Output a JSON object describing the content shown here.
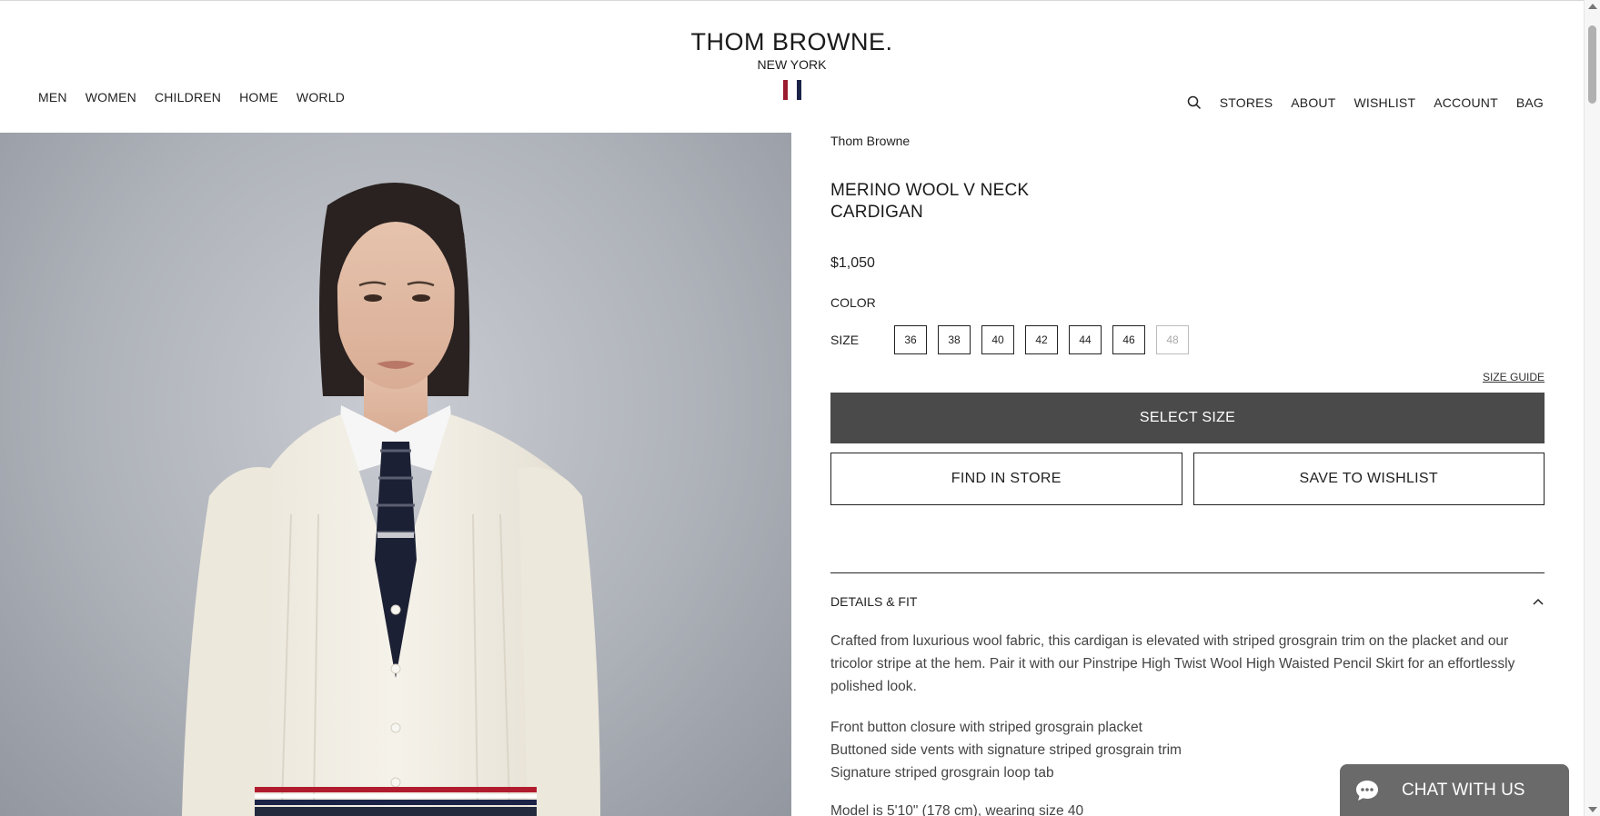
{
  "header": {
    "brand": "THOM BROWNE.",
    "city": "NEW YORK",
    "flag_colors": [
      "#9b1c2e",
      "#ffffff",
      "#1b2347"
    ],
    "nav_left": [
      "MEN",
      "WOMEN",
      "CHILDREN",
      "HOME",
      "WORLD"
    ],
    "nav_right": [
      "STORES",
      "ABOUT",
      "WISHLIST",
      "ACCOUNT",
      "BAG"
    ],
    "search_icon": "search-icon"
  },
  "product": {
    "brand": "Thom Browne",
    "title": "MERINO WOOL V NECK\nCARDIGAN",
    "price": "$1,050",
    "color_label": "COLOR",
    "size_label": "SIZE",
    "sizes": [
      {
        "label": "36",
        "available": true
      },
      {
        "label": "38",
        "available": true
      },
      {
        "label": "40",
        "available": true
      },
      {
        "label": "42",
        "available": true
      },
      {
        "label": "44",
        "available": true
      },
      {
        "label": "46",
        "available": true
      },
      {
        "label": "48",
        "available": false
      }
    ],
    "size_guide": "SIZE GUIDE",
    "primary_button": "SELECT SIZE",
    "find_in_store": "FIND IN STORE",
    "save_to_wishlist": "SAVE TO WISHLIST"
  },
  "details": {
    "heading": "DETAILS & FIT",
    "description": "Crafted from luxurious wool fabric, this cardigan is elevated with striped grosgrain trim on the placket and our tricolor stripe at the hem. Pair it with our Pinstripe High Twist Wool High Waisted Pencil Skirt for an effortlessly polished look.",
    "bullets": [
      "Front button closure with striped grosgrain placket",
      "Buttoned side vents with signature striped grosgrain trim",
      "Signature striped grosgrain loop tab"
    ],
    "model": "Model is 5'10\" (178 cm), wearing size 40"
  },
  "chat": {
    "label": "CHAT WITH US"
  },
  "colors": {
    "primary_button_bg": "#4a4a4a",
    "chat_bg": "#6a6a6a"
  }
}
